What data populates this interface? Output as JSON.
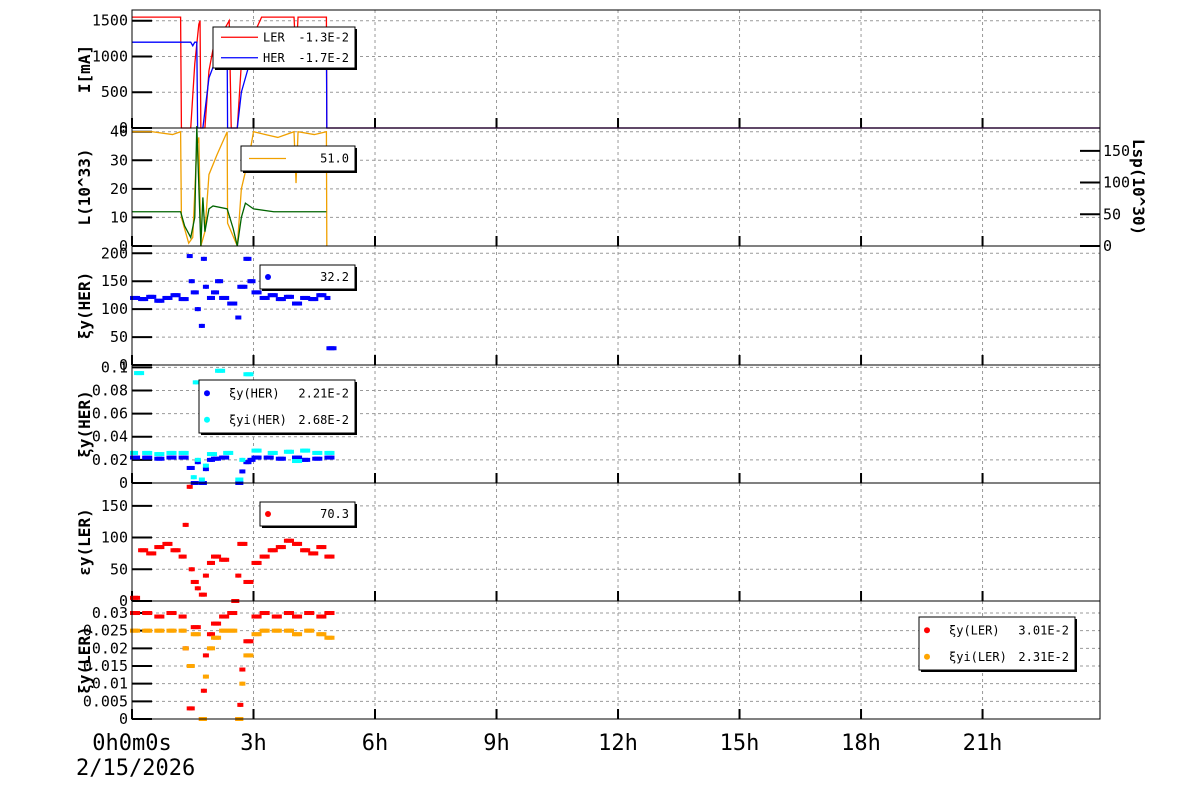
{
  "chart_data": [
    {
      "type": "line",
      "ylabel": "I[mA]",
      "ylim": [
        0,
        1650
      ],
      "yticks": [
        0,
        500,
        1000,
        1500
      ],
      "legend": [
        {
          "label": "LER",
          "value": "-1.3E-2",
          "color": "#ff0000"
        },
        {
          "label": "HER",
          "value": "-1.7E-2",
          "color": "#0000ff"
        }
      ],
      "series": [
        {
          "name": "LER",
          "color": "#ff0000",
          "x": [
            0,
            1.2,
            1.22,
            1.45,
            1.55,
            1.65,
            1.68,
            1.7,
            1.8,
            1.9,
            2.0,
            2.2,
            2.4,
            2.45,
            2.6,
            2.7,
            2.8,
            3.0,
            3.2,
            4.0,
            4.05,
            4.1,
            4.2,
            4.8,
            4.81,
            23.9
          ],
          "y": [
            1550,
            1550,
            0,
            0,
            900,
            1450,
            1500,
            0,
            0,
            800,
            1100,
            1300,
            1500,
            0,
            0,
            900,
            1100,
            1300,
            1550,
            1550,
            1000,
            1550,
            1550,
            1550,
            0,
            0
          ]
        },
        {
          "name": "HER",
          "color": "#0000ff",
          "x": [
            0,
            1.45,
            1.5,
            1.55,
            1.6,
            1.62,
            1.75,
            1.9,
            2.1,
            2.35,
            2.36,
            2.6,
            2.7,
            2.9,
            3.0,
            3.2,
            4.0,
            4.05,
            4.1,
            4.8,
            4.81,
            23.9
          ],
          "y": [
            1200,
            1200,
            1150,
            1200,
            1200,
            0,
            0,
            700,
            1000,
            1050,
            0,
            0,
            500,
            900,
            1200,
            1200,
            1200,
            1000,
            1200,
            1200,
            0,
            0
          ]
        }
      ]
    },
    {
      "type": "line",
      "ylabel": "L(10^33)",
      "ylabel_right": "Lsp(10^30)",
      "ylim": [
        0,
        41.3
      ],
      "yticks": [
        0,
        10,
        20,
        30,
        40
      ],
      "ylim_right": [
        0,
        186
      ],
      "yticks_right": [
        0,
        50,
        100,
        150
      ],
      "legend": [
        {
          "label": "",
          "value": "51.0",
          "color": "#f0a000"
        }
      ],
      "series": [
        {
          "name": "L",
          "color": "#f0a000",
          "x": [
            0,
            0.5,
            1.0,
            1.2,
            1.22,
            1.4,
            1.5,
            1.6,
            1.65,
            1.7,
            1.8,
            1.9,
            2.1,
            2.35,
            2.36,
            2.6,
            2.7,
            2.9,
            3.0,
            3.3,
            3.6,
            4.0,
            4.05,
            4.1,
            4.5,
            4.8,
            4.81
          ],
          "y": [
            40,
            40,
            39,
            40,
            10,
            1,
            3,
            35,
            38,
            0,
            5,
            25,
            32,
            40,
            8,
            0,
            20,
            32,
            40,
            39,
            38,
            40,
            22,
            40,
            39,
            40,
            0
          ]
        },
        {
          "name": "Lsp",
          "color": "#006400",
          "x": [
            0,
            1.2,
            1.3,
            1.45,
            1.55,
            1.6,
            1.7,
            1.75,
            1.8,
            1.9,
            2.0,
            2.35,
            2.5,
            2.6,
            2.7,
            2.8,
            3.0,
            3.5,
            4.0,
            4.8
          ],
          "y": [
            12,
            12,
            7,
            3,
            10,
            42,
            0,
            17,
            5,
            13,
            14,
            13,
            6,
            0,
            10,
            15,
            13,
            12,
            12,
            12
          ]
        }
      ]
    },
    {
      "type": "scatter",
      "ylabel": "ξy(HER)",
      "ylim": [
        0,
        213
      ],
      "yticks": [
        0,
        50,
        100,
        150,
        200
      ],
      "legend": [
        {
          "label": "",
          "value": "32.2",
          "color": "#0000ff"
        }
      ],
      "series": [
        {
          "name": "HER",
          "color": "#0000ff",
          "x": [
            0,
            0.2,
            0.4,
            0.6,
            0.8,
            1.0,
            1.2,
            1.4,
            1.45,
            1.5,
            1.6,
            1.7,
            1.75,
            1.8,
            1.9,
            2.0,
            2.1,
            2.2,
            2.4,
            2.6,
            2.65,
            2.8,
            2.9,
            3.0,
            3.2,
            3.4,
            3.6,
            3.8,
            4.0,
            4.2,
            4.4,
            4.6,
            4.8,
            4.85
          ],
          "y": [
            120,
            118,
            122,
            115,
            120,
            125,
            118,
            195,
            150,
            130,
            100,
            70,
            190,
            140,
            120,
            130,
            150,
            120,
            110,
            85,
            140,
            190,
            150,
            130,
            120,
            125,
            118,
            122,
            110,
            120,
            118,
            125,
            120,
            30
          ]
        }
      ]
    },
    {
      "type": "scatter",
      "ylabel": "ξy(HER)",
      "ylim": [
        0,
        0.102
      ],
      "yticks": [
        0,
        0.02,
        0.04,
        0.06,
        0.08,
        0.1
      ],
      "legend": [
        {
          "label": "ξy(HER)",
          "value": "2.21E-2",
          "color": "#0000ff"
        },
        {
          "label": "ξyi(HER)",
          "value": "2.68E-2",
          "color": "#00ffff"
        }
      ],
      "series": [
        {
          "name": "ξy(HER)",
          "color": "#0000ff",
          "x": [
            0,
            0.3,
            0.6,
            0.9,
            1.2,
            1.4,
            1.5,
            1.6,
            1.7,
            1.8,
            1.9,
            2.0,
            2.2,
            2.6,
            2.7,
            2.8,
            2.9,
            3.0,
            3.3,
            3.6,
            4.0,
            4.2,
            4.5,
            4.8
          ],
          "y": [
            0.022,
            0.022,
            0.021,
            0.022,
            0.022,
            0.013,
            0.0,
            0.018,
            0.0,
            0.012,
            0.02,
            0.021,
            0.022,
            0.0,
            0.01,
            0.018,
            0.02,
            0.022,
            0.022,
            0.021,
            0.022,
            0.02,
            0.021,
            0.022
          ]
        },
        {
          "name": "ξyi(HER)",
          "color": "#00ffff",
          "x": [
            0,
            0.1,
            0.3,
            0.6,
            0.9,
            1.2,
            1.5,
            1.55,
            1.6,
            1.7,
            1.75,
            1.8,
            1.9,
            2.1,
            2.3,
            2.6,
            2.7,
            2.8,
            3.0,
            3.2,
            3.4,
            3.6,
            3.8,
            4.0,
            4.2,
            4.5,
            4.8
          ],
          "y": [
            0.026,
            0.095,
            0.026,
            0.025,
            0.026,
            0.026,
            0.005,
            0.087,
            0.02,
            0.003,
            0.045,
            0.015,
            0.025,
            0.097,
            0.026,
            0.003,
            0.02,
            0.094,
            0.028,
            0.06,
            0.026,
            0.068,
            0.027,
            0.019,
            0.028,
            0.026,
            0.026
          ]
        }
      ]
    },
    {
      "type": "scatter",
      "ylabel": "εy(LER)",
      "ylim": [
        0,
        186
      ],
      "yticks": [
        0,
        50,
        100,
        150
      ],
      "legend": [
        {
          "label": "",
          "value": "70.3",
          "color": "#ff0000"
        }
      ],
      "series": [
        {
          "name": "LER",
          "color": "#ff0000",
          "x": [
            0,
            0.2,
            0.4,
            0.6,
            0.8,
            1.0,
            1.2,
            1.3,
            1.4,
            1.45,
            1.5,
            1.6,
            1.7,
            1.8,
            1.9,
            2.0,
            2.2,
            2.5,
            2.6,
            2.65,
            2.8,
            3.0,
            3.2,
            3.4,
            3.6,
            3.8,
            4.0,
            4.2,
            4.4,
            4.6,
            4.8
          ],
          "y": [
            5,
            80,
            75,
            85,
            90,
            80,
            70,
            120,
            180,
            50,
            30,
            20,
            10,
            40,
            60,
            70,
            65,
            0,
            40,
            90,
            30,
            60,
            70,
            80,
            85,
            95,
            90,
            80,
            75,
            85,
            70
          ]
        }
      ]
    },
    {
      "type": "scatter",
      "ylabel": "ξy(LER)",
      "ylim": [
        0,
        0.0334
      ],
      "yticks": [
        0,
        0.005,
        0.01,
        0.015,
        0.02,
        0.025,
        0.03
      ],
      "legend": [
        {
          "label": "ξy(LER)",
          "value": "3.01E-2",
          "color": "#ff0000"
        },
        {
          "label": "ξyi(LER)",
          "value": "2.31E-2",
          "color": "#ffa500"
        }
      ],
      "series": [
        {
          "name": "ξy(LER)",
          "color": "#ff0000",
          "x": [
            0,
            0.3,
            0.6,
            0.9,
            1.2,
            1.3,
            1.4,
            1.5,
            1.7,
            1.75,
            1.8,
            1.9,
            2.0,
            2.2,
            2.4,
            2.6,
            2.65,
            2.7,
            2.8,
            3.0,
            3.2,
            3.5,
            3.8,
            4.0,
            4.3,
            4.6,
            4.8
          ],
          "y": [
            0.03,
            0.03,
            0.029,
            0.03,
            0.029,
            0.02,
            0.003,
            0.026,
            0.0,
            0.008,
            0.018,
            0.024,
            0.027,
            0.029,
            0.03,
            0.0,
            0.004,
            0.014,
            0.022,
            0.029,
            0.03,
            0.029,
            0.03,
            0.029,
            0.03,
            0.029,
            0.03
          ]
        },
        {
          "name": "ξyi(LER)",
          "color": "#ffa500",
          "x": [
            0,
            0.3,
            0.6,
            0.9,
            1.2,
            1.3,
            1.4,
            1.5,
            1.7,
            1.8,
            1.9,
            2.0,
            2.2,
            2.4,
            2.6,
            2.7,
            2.8,
            3.0,
            3.2,
            3.5,
            3.8,
            4.0,
            4.3,
            4.6,
            4.8
          ],
          "y": [
            0.025,
            0.025,
            0.025,
            0.025,
            0.025,
            0.02,
            0.015,
            0.024,
            0.0,
            0.012,
            0.02,
            0.023,
            0.025,
            0.025,
            0.0,
            0.01,
            0.018,
            0.024,
            0.025,
            0.025,
            0.025,
            0.024,
            0.025,
            0.024,
            0.023
          ]
        }
      ]
    }
  ],
  "x_axis": {
    "xlim": [
      0,
      23.9
    ],
    "ticks": [
      {
        "v": 0,
        "label": "0h0m0s"
      },
      {
        "v": 3,
        "label": "3h"
      },
      {
        "v": 6,
        "label": "6h"
      },
      {
        "v": 9,
        "label": "9h"
      },
      {
        "v": 12,
        "label": "12h"
      },
      {
        "v": 15,
        "label": "15h"
      },
      {
        "v": 18,
        "label": "18h"
      },
      {
        "v": 21,
        "label": "21h"
      }
    ],
    "date": "2/15/2026"
  }
}
